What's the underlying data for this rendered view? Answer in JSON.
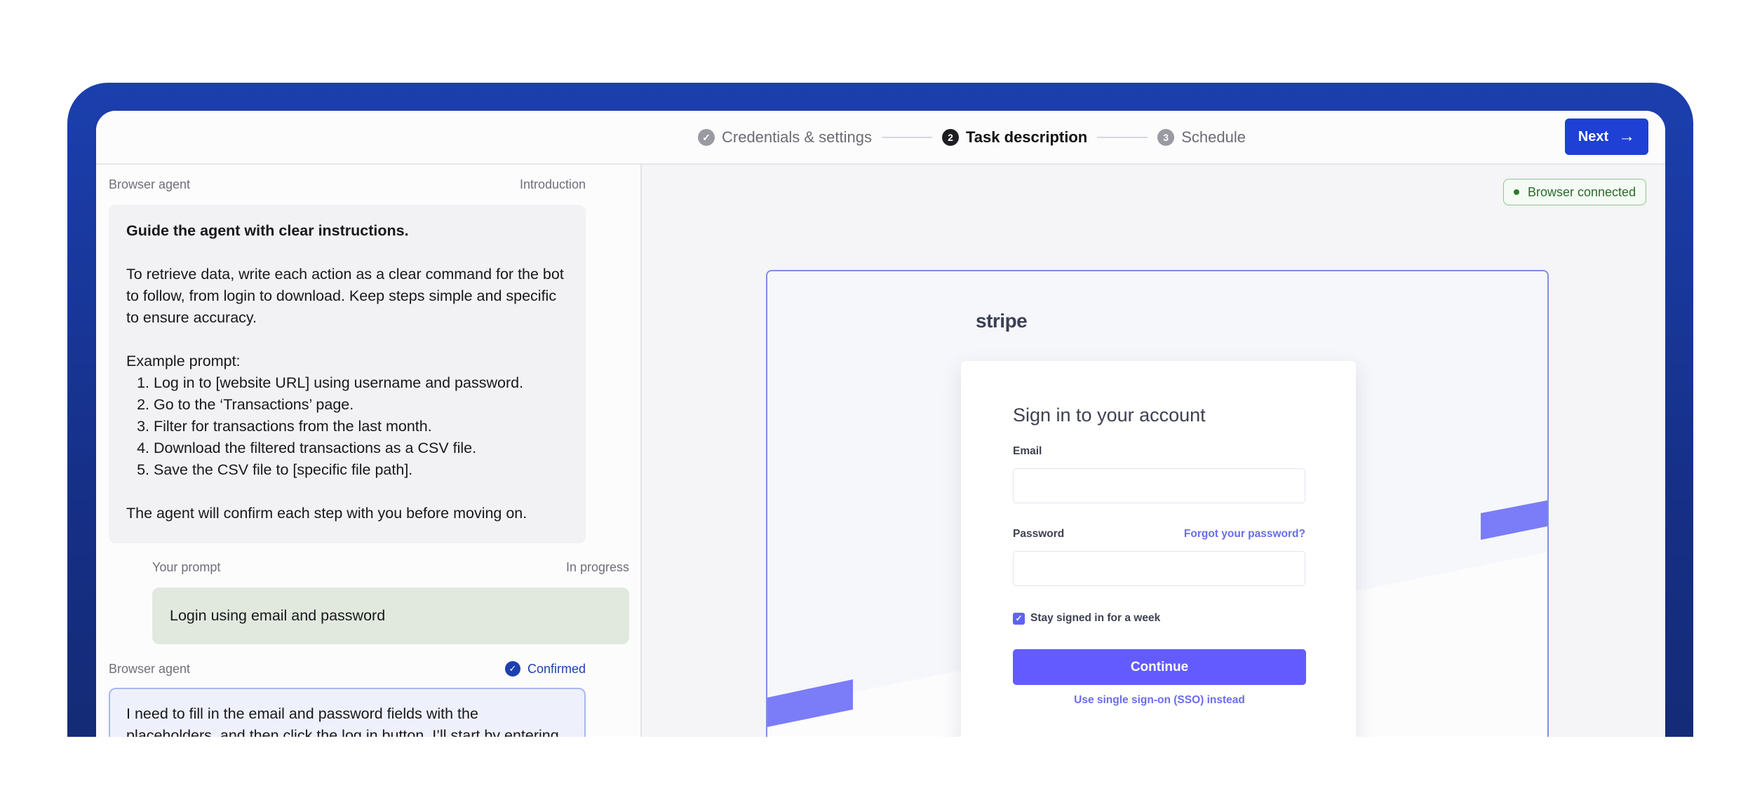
{
  "header": {
    "steps": [
      {
        "label": "Credentials & settings",
        "marker": "✓",
        "state": "done"
      },
      {
        "label": "Task description",
        "marker": "2",
        "state": "active"
      },
      {
        "label": "Schedule",
        "marker": "3",
        "state": "pending"
      }
    ],
    "next_label": "Next",
    "next_icon": "arrow-right-icon"
  },
  "chat": {
    "agent_intro": {
      "sender": "Browser agent",
      "status": "Introduction",
      "heading": "Guide the agent with clear instructions.",
      "body": "To retrieve data, write each action as a clear command for the bot to follow, from login to download. Keep steps simple and specific to ensure accuracy.",
      "example_label": "Example prompt:",
      "steps": [
        "Log in to [website URL] using username and password.",
        "Go to the ‘Transactions’ page.",
        "Filter for transactions from the last month.",
        "Download the filtered transactions as a CSV file.",
        "Save the CSV file to [specific file path]."
      ],
      "closing": "The agent will confirm each step with you before moving on."
    },
    "user_prompt": {
      "sender": "Your prompt",
      "status": "In progress",
      "text": "Login using email and password"
    },
    "agent_reply": {
      "sender": "Browser agent",
      "status": "Confirmed",
      "text": "I need to fill in the email and password fields with the placeholders, and then click the log in button. I’ll start by entering"
    }
  },
  "browser": {
    "status_badge": "Browser connected",
    "status_color": "#2a7a2a",
    "logo": "stripe",
    "card": {
      "title": "Sign in to your account",
      "email_label": "Email",
      "password_label": "Password",
      "forgot_link": "Forgot your password?",
      "remember_label": "Stay signed in for a week",
      "remember_checked": true,
      "continue_label": "Continue",
      "sso_link": "Use single sign-on (SSO) instead"
    },
    "accent_color": "#635bff"
  }
}
